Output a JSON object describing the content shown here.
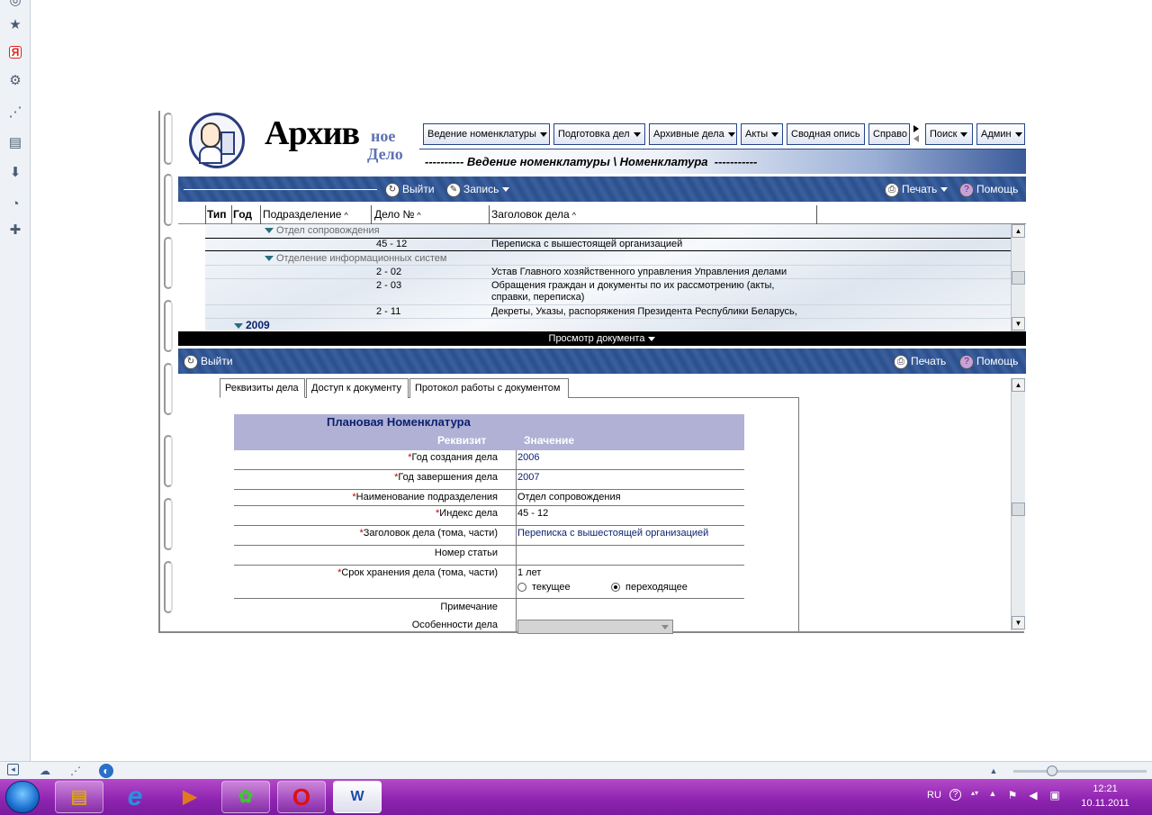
{
  "opera_sidebar": {
    "icons": [
      "opera-icon",
      "star-icon",
      "yandex-icon",
      "gear-icon",
      "share-icon",
      "notes-icon",
      "download-icon",
      "clock-icon",
      "plus-icon"
    ]
  },
  "app": {
    "logo": {
      "main": "Архив",
      "sub1": "ное",
      "sub2": "Дело"
    },
    "menu": [
      {
        "label": "Ведение номенклатуры",
        "dropdown": true
      },
      {
        "label": "Подготовка дел",
        "dropdown": true
      },
      {
        "label": "Архивные дела",
        "dropdown": true
      },
      {
        "label": "Акты",
        "dropdown": true
      },
      {
        "label": "Сводная опись",
        "dropdown": false
      },
      {
        "label": "Справо",
        "dropdown": false
      },
      {
        "label": "Поиск",
        "dropdown": true
      },
      {
        "label": "Админ",
        "dropdown": true
      }
    ],
    "breadcrumb": "---------- Ведение номенклатуры \\ Номенклатура  -----------",
    "top_toolbar": {
      "exit": "Выйти",
      "record": "Запись",
      "print": "Печать",
      "help": "Помощь"
    },
    "grid": {
      "columns": [
        "Тип",
        "Год",
        "Подразделение",
        "Дело №",
        "Заголовок дела"
      ],
      "rows": [
        {
          "type": "group",
          "label": "Отдел сопровождения"
        },
        {
          "type": "item",
          "case": "45 - 12",
          "title": "Переписка с вышестоящей организацией",
          "selected": true
        },
        {
          "type": "group",
          "label": "Отделение информационных систем"
        },
        {
          "type": "item",
          "case": "2 - 02",
          "title": "Устав  Главного хозяйственного управления Управления делами"
        },
        {
          "type": "item",
          "case": "2 - 03",
          "title": "Обращения граждан и документы по их рассмотрению (акты,",
          "title2": "справки, переписка)"
        },
        {
          "type": "item",
          "case": "2 - 11",
          "title": "Декреты, Указы, распоряжения Президента Республики Беларусь,"
        }
      ],
      "year_group": "2009"
    },
    "preview_bar": "Просмотр документа",
    "lower_toolbar": {
      "exit": "Выйти",
      "print": "Печать",
      "help": "Помощь"
    },
    "tabs": [
      "Реквизиты дела",
      "Доступ к документу",
      "Протокол работы с документом"
    ],
    "props": {
      "title": "Плановая Номенклатура",
      "col_attr": "Реквизит",
      "col_value": "Значение",
      "rows": [
        {
          "label": "Год создания дела",
          "required": true,
          "value": "2006"
        },
        {
          "label": "Год завершения дела",
          "required": true,
          "value": "2007"
        },
        {
          "label": "Наименование подразделения",
          "required": true,
          "value": "Отдел сопровождения"
        },
        {
          "label": "Индекс дела",
          "required": true,
          "value": "45 - 12"
        },
        {
          "label": "Заголовок дела (тома, части)",
          "required": true,
          "value": "Переписка с вышестоящей организацией"
        },
        {
          "label": "Номер статьи",
          "required": false,
          "value": ""
        },
        {
          "label": "Срок хранения дела (тома, части)",
          "required": true,
          "value": "1 лет"
        },
        {
          "label": "Примечание",
          "required": false,
          "value": ""
        },
        {
          "label": "Особенности дела",
          "required": false,
          "value": ""
        }
      ],
      "radio": {
        "current": "текущее",
        "transitional": "переходящее",
        "selected": "transitional"
      }
    }
  },
  "taskbar": {
    "lang": "RU",
    "time": "12:21",
    "date": "10.11.2011",
    "apps": [
      "explorer",
      "ie",
      "media-player",
      "icq",
      "opera",
      "word"
    ]
  }
}
